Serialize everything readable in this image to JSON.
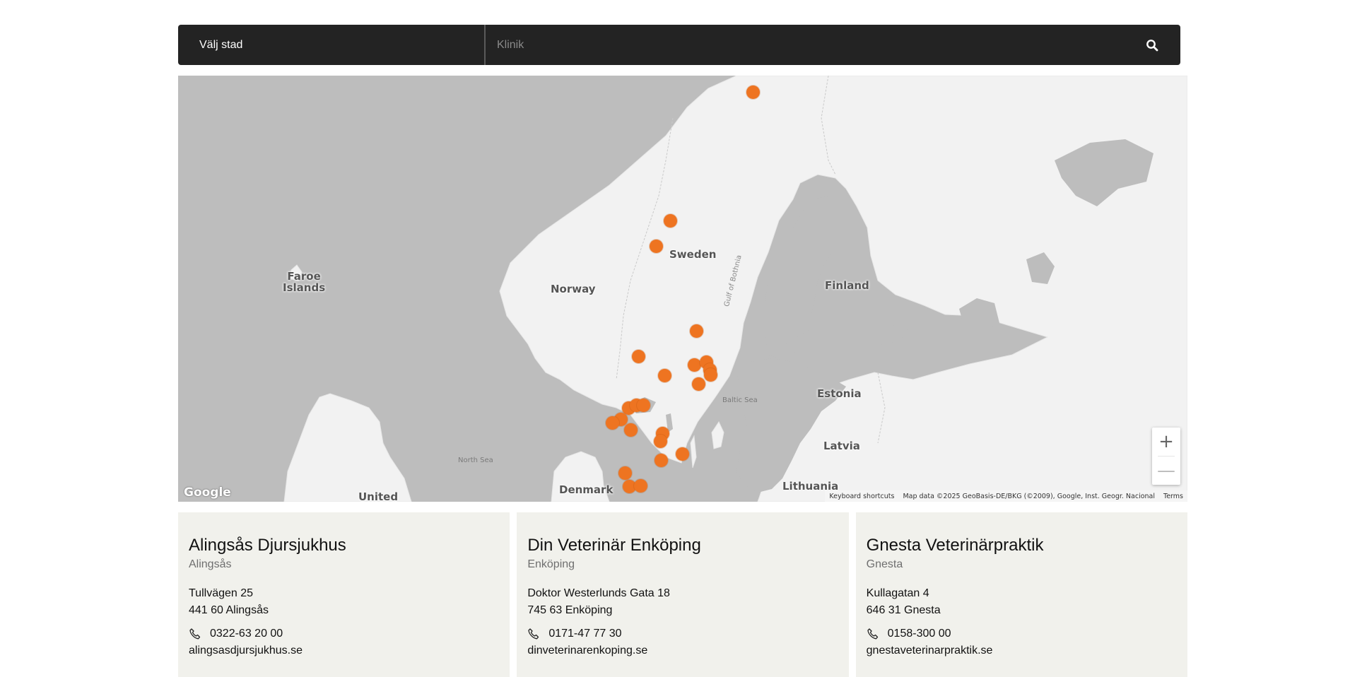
{
  "search": {
    "city_label": "Välj stad",
    "clinic_placeholder": "Klinik"
  },
  "map": {
    "labels": {
      "faroe": "Faroe\nIslands",
      "norway": "Norway",
      "sweden": "Sweden",
      "finland": "Finland",
      "estonia": "Estonia",
      "latvia": "Latvia",
      "lithuania": "Lithuania",
      "denmark": "Denmark",
      "united": "United",
      "north_sea": "North Sea",
      "baltic_sea": "Baltic Sea",
      "gulf_bothnia": "Gulf of Bothnia"
    },
    "google": "Google",
    "attribution": {
      "shortcuts": "Keyboard shortcuts",
      "data": "Map data ©2025 GeoBasis-DE/BKG (©2009), Google, Inst. Geogr. Nacional",
      "terms": "Terms"
    },
    "zoom_in": "+",
    "zoom_out": "—"
  },
  "clinics": [
    {
      "name": "Alingsås Djursjukhus",
      "city": "Alingsås",
      "street": "Tullvägen 25",
      "postal": "441 60 Alingsås",
      "phone": "0322-63 20 00",
      "website": "alingsasdjursjukhus.se"
    },
    {
      "name": "Din Veterinär Enköping",
      "city": "Enköping",
      "street": "Doktor Westerlunds Gata 18",
      "postal": "745 63 Enköping",
      "phone": "0171-47 77 30",
      "website": "dinveterinarenkoping.se"
    },
    {
      "name": "Gnesta Veterinärpraktik",
      "city": "Gnesta",
      "street": "Kullagatan 4",
      "postal": "646 31 Gnesta",
      "phone": "0158-300 00",
      "website": "gnestaveterinarpraktik.se"
    }
  ],
  "colors": {
    "marker": "#ee7421",
    "searchbar": "#232323",
    "card_bg": "#f1f1ec",
    "water": "#bdbdbd",
    "land": "#f2f2f2"
  }
}
